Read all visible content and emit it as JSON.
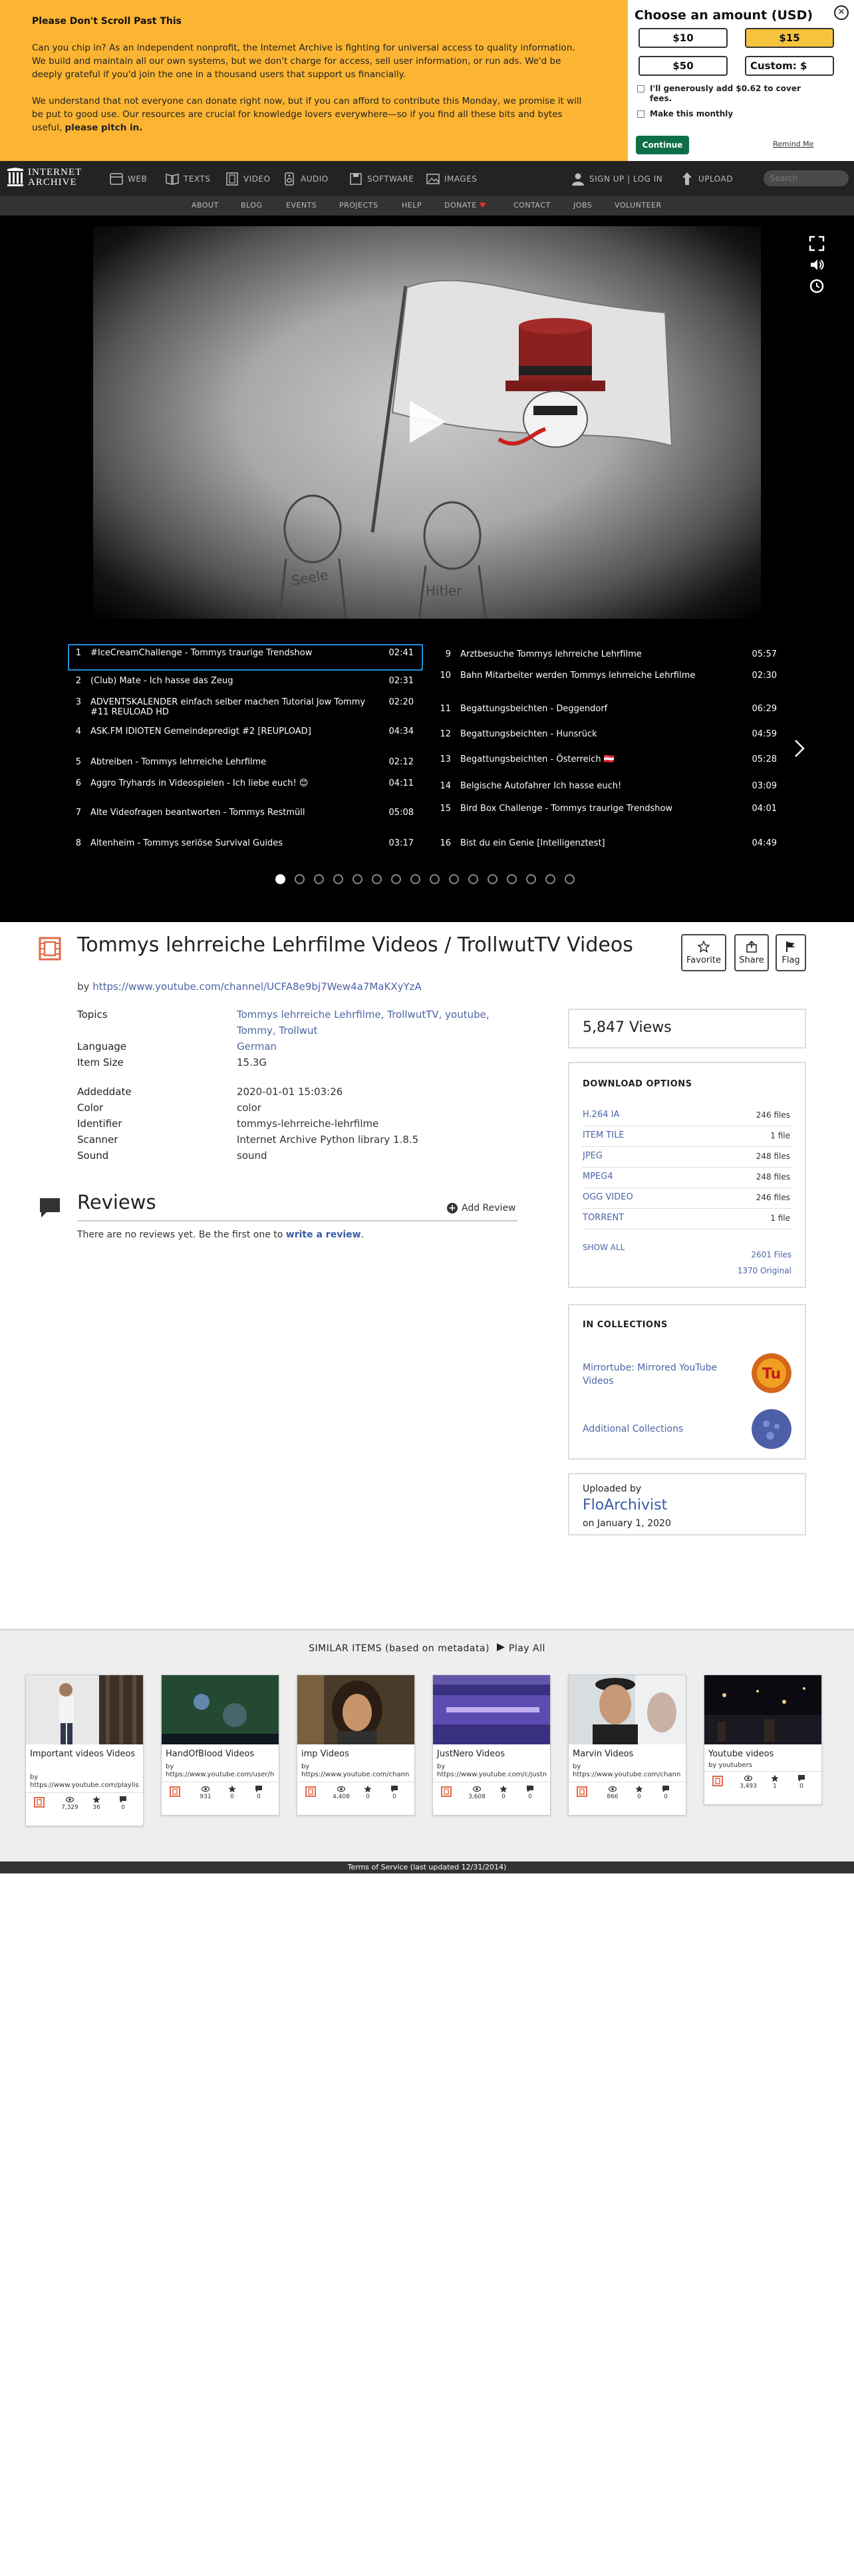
{
  "banner": {
    "title": "Please Don't Scroll Past This",
    "para1": "Can you chip in? As an independent nonprofit, the Internet Archive is fighting for universal access to quality information. We build and maintain all our own systems, but we don't charge for access, sell user information, or run ads. We'd be deeply grateful if you'd join the one in a thousand users that support us financially.",
    "para2": "We understand that not everyone can donate right now, but if you can afford to contribute this Monday, we promise it will be put to good use. Our resources are crucial for knowledge lovers everywhere—so if you find all these bits and bytes useful,",
    "para2_bold": "please pitch in.",
    "amount_heading": "Choose an amount (USD)",
    "amounts": [
      "$10",
      "$15",
      "$50"
    ],
    "custom_label": "Custom: $",
    "cover_fees": "I'll generously add $0.62 to cover fees.",
    "monthly": "Make this monthly",
    "continue": "Continue",
    "remind": "Remind Me",
    "close": "✕"
  },
  "nav": {
    "logo_line1": "INTERNET",
    "logo_line2": "ARCHIVE",
    "items": [
      "WEB",
      "TEXTS",
      "VIDEO",
      "AUDIO",
      "SOFTWARE",
      "IMAGES"
    ],
    "signin": "SIGN UP | LOG IN",
    "upload": "UPLOAD",
    "search_placeholder": "Search",
    "sub": [
      "ABOUT",
      "BLOG",
      "EVENTS",
      "PROJECTS",
      "HELP",
      "DONATE",
      "CONTACT",
      "JOBS",
      "VOLUNTEER"
    ],
    "donate_heart": "♥"
  },
  "playlist": [
    {
      "n": "1",
      "title": "#IceCreamChallenge - Tommys traurige Trendshow",
      "dur": "02:41"
    },
    {
      "n": "2",
      "title": "(Club) Mate - Ich hasse das Zeug",
      "dur": "02:31"
    },
    {
      "n": "3",
      "title": "ADVENTSKALENDER einfach selber machen Tutorial Jow Tommy #11 REULOAD HD",
      "dur": "02:20"
    },
    {
      "n": "4",
      "title": "ASK.FM IDIOTEN Gemeindepredigt #2 [REUPLOAD]",
      "dur": "04:34"
    },
    {
      "n": "5",
      "title": "Abtreiben - Tommys lehrreiche Lehrfilme",
      "dur": "02:12"
    },
    {
      "n": "6",
      "title": "Aggro Tryhards in Videospielen - Ich liebe euch! 😊",
      "dur": "04:11"
    },
    {
      "n": "7",
      "title": "Alte Videofragen beantworten - Tommys Restmüll",
      "dur": "05:08"
    },
    {
      "n": "8",
      "title": "Altenheim - Tommys seriöse Survival Guides",
      "dur": "03:17"
    },
    {
      "n": "9",
      "title": "Arztbesuche Tommys lehrreiche Lehrfilme",
      "dur": "05:57"
    },
    {
      "n": "10",
      "title": "Bahn Mitarbeiter werden Tommys lehrreiche Lehrfilme",
      "dur": "02:30"
    },
    {
      "n": "11",
      "title": "Begattungsbeichten - Deggendorf",
      "dur": "06:29"
    },
    {
      "n": "12",
      "title": "Begattungsbeichten - Hunsrück",
      "dur": "04:59"
    },
    {
      "n": "13",
      "title": "Begattungsbeichten - Österreich 🇦🇹",
      "dur": "05:28"
    },
    {
      "n": "14",
      "title": "Belgische Autofahrer Ich hasse euch!",
      "dur": "03:09"
    },
    {
      "n": "15",
      "title": "Bird Box Challenge - Tommys traurige Trendshow",
      "dur": "04:01"
    },
    {
      "n": "16",
      "title": "Bist du ein Genie [Intelligenztest]",
      "dur": "04:49"
    }
  ],
  "item": {
    "title": "Tommys lehrreiche Lehrfilme Videos / TrollwutTV Videos",
    "by_prefix": "by",
    "by_link": "https://www.youtube.com/channel/UCFA8e9bj7Wew4a7MaKXyYzA",
    "favorite": "Favorite",
    "share": "Share",
    "flag": "Flag",
    "meta": {
      "topics_k": "Topics",
      "topics_line1": "Tommys lehrreiche Lehrfilme, TrollwutTV, youtube,",
      "topics_line2": "Tommy, Trollwut",
      "language_k": "Language",
      "language_v": "German",
      "size_k": "Item Size",
      "size_v": "15.3G",
      "added_k": "Addeddate",
      "added_v": "2020-01-01 15:03:26",
      "color_k": "Color",
      "color_v": "color",
      "id_k": "Identifier",
      "id_v": "tommys-lehrreiche-lehrfilme",
      "scanner_k": "Scanner",
      "scanner_v": "Internet Archive Python library 1.8.5",
      "sound_k": "Sound",
      "sound_v": "sound"
    }
  },
  "reviews": {
    "title": "Reviews",
    "add": "Add Review",
    "none_text": "There are no reviews yet. Be the first one to",
    "write_link": "write a review",
    "period": "."
  },
  "sidebar": {
    "views": "5,847 Views",
    "download_heading": "DOWNLOAD OPTIONS",
    "downloads": [
      {
        "name": "H.264 IA",
        "count": "246 files"
      },
      {
        "name": "ITEM TILE",
        "count": "1 file"
      },
      {
        "name": "JPEG",
        "count": "248 files"
      },
      {
        "name": "MPEG4",
        "count": "248 files"
      },
      {
        "name": "OGG VIDEO",
        "count": "246 files"
      },
      {
        "name": "TORRENT",
        "count": "1 file"
      }
    ],
    "show_all": "SHOW ALL",
    "files": "2601 Files",
    "original": "1370 Original",
    "collections_heading": "IN COLLECTIONS",
    "collections": [
      "Mirrortube: Mirrored YouTube Videos",
      "Additional Collections"
    ],
    "uploaded_by": "Uploaded by",
    "uploader": "FloArchivist",
    "uploaded_on": "on January 1, 2020"
  },
  "similar": {
    "heading": "SIMILAR ITEMS (based on metadata)",
    "play_all": "Play All",
    "tiles": [
      {
        "title": "Important videos Videos",
        "by": "by",
        "creator": "https://www.youtube.com/playlis",
        "views": "7,329",
        "favs": "36",
        "reviews": "0"
      },
      {
        "title": "HandOfBlood Videos",
        "by": "by",
        "creator": "https://www.youtube.com/user/h",
        "views": "931",
        "favs": "0",
        "reviews": "0"
      },
      {
        "title": "imp Videos",
        "by": "by",
        "creator": "https://www.youtube.com/chann",
        "views": "4,408",
        "favs": "0",
        "reviews": "0"
      },
      {
        "title": "JustNero Videos",
        "by": "by",
        "creator": "https://www.youtube.com/c/justn",
        "views": "3,608",
        "favs": "0",
        "reviews": "0"
      },
      {
        "title": "Marvin Videos",
        "by": "by",
        "creator": "https://www.youtube.com/chann",
        "views": "866",
        "favs": "0",
        "reviews": "0"
      },
      {
        "title": "Youtube videos",
        "by": "by",
        "creator": "youtubers",
        "views": "3,493",
        "favs": "1",
        "reviews": "0"
      }
    ]
  },
  "footer": "Terms of Service (last updated 12/31/2014)",
  "colors": {
    "banner": "#fcb532",
    "link": "#4b64a5",
    "nav_bg": "#232323",
    "continue_bg": "#0e6e4a"
  }
}
